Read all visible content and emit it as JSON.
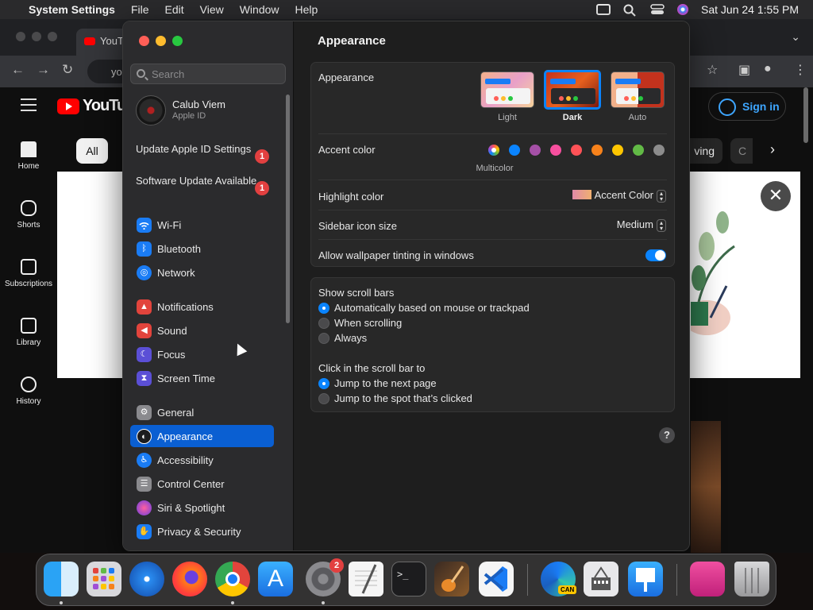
{
  "menubar": {
    "app_name": "System Settings",
    "menus": [
      "File",
      "Edit",
      "View",
      "Window",
      "Help"
    ],
    "clock": "Sat Jun 24  1:55 PM"
  },
  "browser": {
    "tab_title": "YouT",
    "url_partial": "yo",
    "youtube": {
      "logo_text": "YouTub",
      "sign_in": "Sign in",
      "chips": [
        "All",
        "ving",
        "C"
      ],
      "side_items": [
        "Home",
        "Shorts",
        "Subscriptions",
        "Library",
        "History"
      ]
    }
  },
  "settings": {
    "search_placeholder": "Search",
    "apple_id": {
      "name": "Calub Viem",
      "subtitle": "Apple ID"
    },
    "notices": [
      {
        "label": "Update Apple ID Settings",
        "badge": "1"
      },
      {
        "label": "Software Update Available",
        "badge": "1"
      }
    ],
    "sidebar_groups": [
      [
        {
          "label": "Wi-Fi",
          "icon": "wifi-icon",
          "color": "#1a7cf5"
        },
        {
          "label": "Bluetooth",
          "icon": "bluetooth-icon",
          "color": "#1a7cf5"
        },
        {
          "label": "Network",
          "icon": "globe-icon",
          "color": "#1a7cf5"
        }
      ],
      [
        {
          "label": "Notifications",
          "icon": "bell-icon",
          "color": "#e2443c"
        },
        {
          "label": "Sound",
          "icon": "speaker-icon",
          "color": "#e2443c"
        },
        {
          "label": "Focus",
          "icon": "moon-icon",
          "color": "#5b4fd6"
        },
        {
          "label": "Screen Time",
          "icon": "hourglass-icon",
          "color": "#5b4fd6"
        }
      ],
      [
        {
          "label": "General",
          "icon": "gear-icon",
          "color": "#8a8a8e"
        },
        {
          "label": "Appearance",
          "icon": "appearance-icon",
          "color": "#1c1c1e",
          "active": true
        },
        {
          "label": "Accessibility",
          "icon": "accessibility-icon",
          "color": "#1a7cf5"
        },
        {
          "label": "Control Center",
          "icon": "control-center-icon",
          "color": "#8a8a8e"
        },
        {
          "label": "Siri & Spotlight",
          "icon": "siri-icon",
          "color": "#b04fd6"
        },
        {
          "label": "Privacy & Security",
          "icon": "hand-icon",
          "color": "#1a7cf5"
        }
      ]
    ],
    "content": {
      "title": "Appearance",
      "appearance": {
        "label": "Appearance",
        "options": [
          {
            "label": "Light",
            "selected": false
          },
          {
            "label": "Dark",
            "selected": true
          },
          {
            "label": "Auto",
            "selected": false
          }
        ]
      },
      "accent": {
        "label": "Accent color",
        "caption": "Multicolor",
        "colors": [
          "#a04fd6",
          "#0a84ff",
          "#a550a7",
          "#f74f9e",
          "#ff5257",
          "#f7821b",
          "#ffc600",
          "#62ba46",
          "#8c8c8c"
        ]
      },
      "highlight": {
        "label": "Highlight color",
        "value": "Accent Color"
      },
      "sidebar_icon_size": {
        "label": "Sidebar icon size",
        "value": "Medium"
      },
      "wallpaper_tinting": {
        "label": "Allow wallpaper tinting in windows",
        "on": true
      },
      "scroll_bars": {
        "label": "Show scroll bars",
        "options": [
          {
            "label": "Automatically based on mouse or trackpad",
            "selected": true
          },
          {
            "label": "When scrolling",
            "selected": false
          },
          {
            "label": "Always",
            "selected": false
          }
        ]
      },
      "click_scroll": {
        "label": "Click in the scroll bar to",
        "options": [
          {
            "label": "Jump to the next page",
            "selected": true
          },
          {
            "label": "Jump to the spot that’s clicked",
            "selected": false
          }
        ]
      },
      "help": "?"
    }
  },
  "dock": {
    "apps": [
      "Finder",
      "Launchpad",
      "Safari",
      "Firefox",
      "Google Chrome",
      "App Store",
      "System Settings",
      "TextEdit",
      "Terminal",
      "GarageBand",
      "Visual Studio Code",
      "Microsoft Edge Canary",
      "Archive Utility",
      "Keynote",
      "Folder",
      "Trash"
    ],
    "settings_badge": "2",
    "edge_label": "CAN"
  }
}
